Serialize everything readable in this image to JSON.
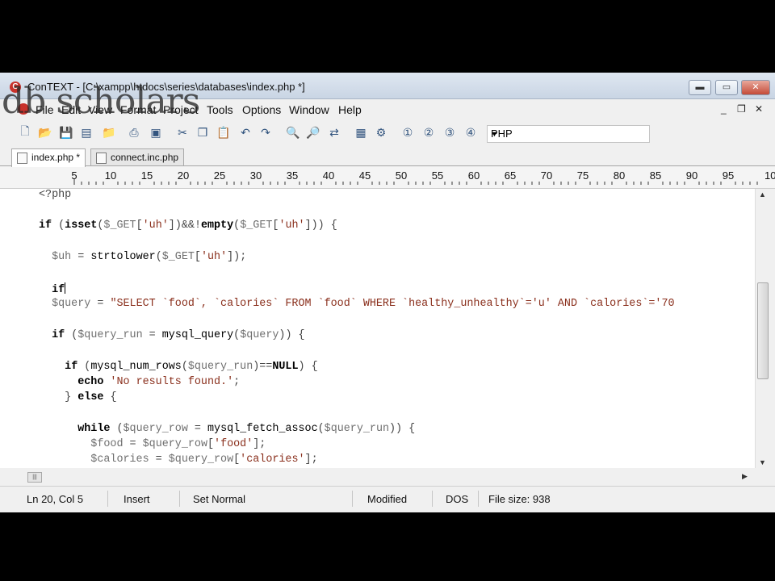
{
  "window": {
    "app_name": "ConTEXT",
    "title": "ConTEXT - [C:\\xampp\\htdocs\\series\\databases\\index.php *]",
    "controls": {
      "minimize": "▬",
      "maximize": "▭",
      "close": "✕"
    }
  },
  "watermark": "db scholars",
  "menubar": {
    "items": [
      "File",
      "Edit",
      "View",
      "Format",
      "Project",
      "Tools",
      "Options",
      "Window",
      "Help"
    ],
    "mdi_controls": {
      "minimize": "_",
      "restore": "❐",
      "close": "✕"
    }
  },
  "toolbar": {
    "icons": [
      "new-file-icon",
      "open-folder-icon",
      "save-icon",
      "save-all-icon",
      "open-project-icon",
      "print-icon",
      "print-preview-icon",
      "cut-icon",
      "copy-icon",
      "paste-icon",
      "undo-icon",
      "redo-icon",
      "find-icon",
      "find-next-icon",
      "replace-icon",
      "export-icon",
      "options-icon",
      "user-command-1-icon",
      "user-command-2-icon",
      "user-command-3-icon",
      "user-command-4-icon"
    ],
    "highlighter": "PHP"
  },
  "tabs": [
    {
      "label": "index.php *",
      "active": true
    },
    {
      "label": "connect.inc.php",
      "active": false
    }
  ],
  "ruler": {
    "labels": [
      "5",
      "10",
      "15",
      "20",
      "25",
      "30",
      "35",
      "40",
      "45",
      "50",
      "55",
      "60",
      "65",
      "70",
      "75",
      "80",
      "85",
      "90",
      "95",
      "10"
    ]
  },
  "code": {
    "lines": [
      "<?php",
      "",
      "if (isset($_GET['uh'])&&!empty($_GET['uh'])) {",
      "",
      "  $uh = strtolower($_GET['uh']);",
      "",
      "  if",
      "  $query = \"SELECT `food`, `calories` FROM `food` WHERE `healthy_unhealthy`='u' AND `calories`='70",
      "",
      "  if ($query_run = mysql_query($query)) {",
      "",
      "    if (mysql_num_rows($query_run)==NULL) {",
      "      echo 'No results found.';",
      "    } else {",
      "",
      "      while ($query_row = mysql_fetch_assoc($query_run)) {",
      "        $food = $query_row['food'];",
      "        $calories = $query_row['calories'];"
    ]
  },
  "statusbar": {
    "position": "Ln 20, Col 5",
    "mode": "Insert",
    "selection": "Set Normal",
    "state": "Modified",
    "line_endings": "DOS",
    "file_size": "File size: 938"
  }
}
